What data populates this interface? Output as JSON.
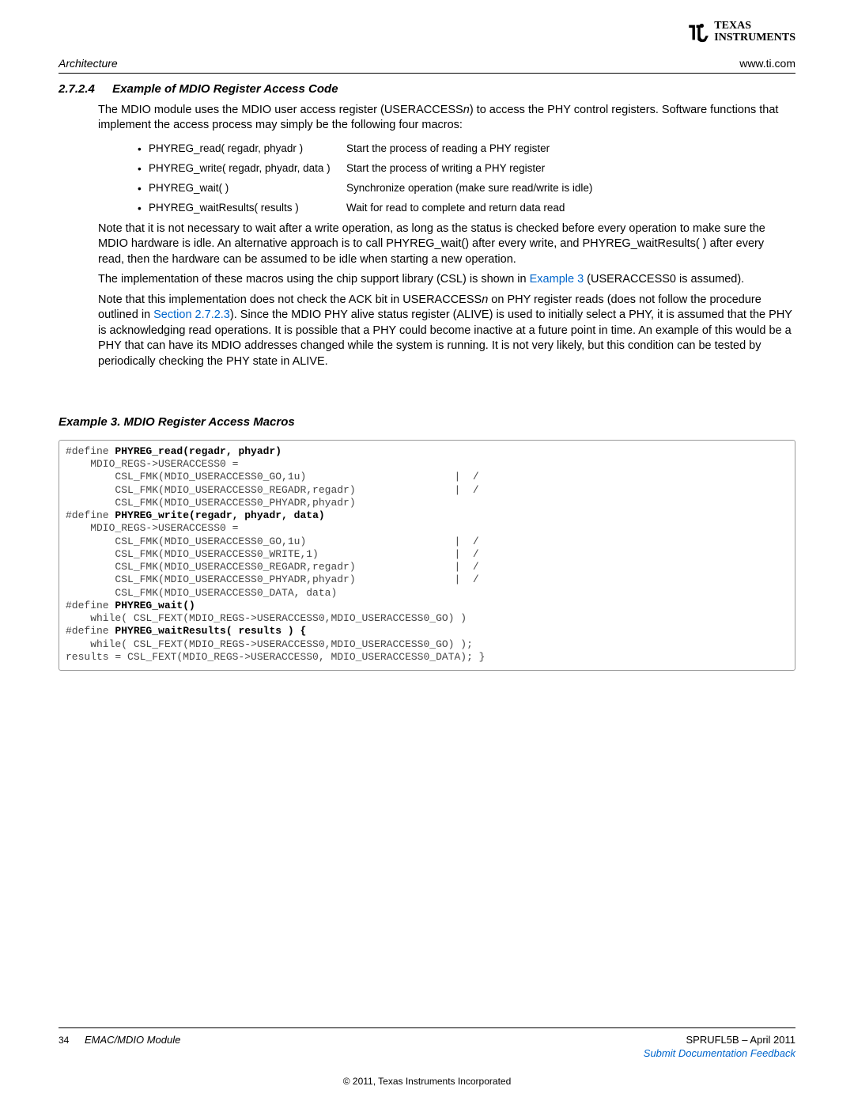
{
  "header": {
    "left": "Architecture",
    "right": "www.ti.com",
    "logo_top": "TEXAS",
    "logo_bottom": "INSTRUMENTS"
  },
  "section": {
    "number": "2.7.2.4",
    "title": "Example of MDIO Register Access Code"
  },
  "paragraphs": {
    "p1a": "The MDIO module uses the MDIO user access register (USERACCESS",
    "p1b": "n",
    "p1c": ") to access the PHY control registers. Software functions that implement the access process may simply be the following four macros:",
    "p2": "Note that it is not necessary to wait after a write operation, as long as the status is checked before every operation to make sure the MDIO hardware is idle. An alternative approach is to call PHYREG_wait() after every write, and PHYREG_waitResults( ) after every read, then the hardware can be assumed to be idle when starting a new operation.",
    "p3a": "The implementation of these macros using the chip support library (CSL) is shown in ",
    "p3_link": "Example 3",
    "p3b": " (USERACCESS0 is assumed).",
    "p4a": "Note that this implementation does not check the ACK bit in USERACCESS",
    "p4b": "n",
    "p4c": " on PHY register reads (does not follow the procedure outlined in ",
    "p4_link": "Section 2.7.2.3",
    "p4d": "). Since the MDIO PHY alive status register (ALIVE) is used to initially select a PHY, it is assumed that the PHY is acknowledging read operations. It is possible that a PHY could become inactive at a future point in time. An example of this would be a PHY that can have its MDIO addresses changed while the system is running. It is not very likely, but this condition can be tested by periodically checking the PHY state in ALIVE."
  },
  "macros": [
    {
      "name": "PHYREG_read( regadr, phyadr )",
      "desc": "Start the process of reading a PHY register"
    },
    {
      "name": "PHYREG_write( regadr, phyadr, data )",
      "desc": "Start the process of writing a PHY register"
    },
    {
      "name": "PHYREG_wait( )",
      "desc": "Synchronize operation (make sure read/write is idle)"
    },
    {
      "name": "PHYREG_waitResults( results )",
      "desc": "Wait for read to complete and return data read"
    }
  ],
  "example": {
    "title": "Example 3. MDIO Register Access Macros"
  },
  "code": {
    "l01a": "#define ",
    "l01b": "PHYREG_read(regadr, phyadr)",
    "l02": "    MDIO_REGS->USERACCESS0 =",
    "l03": "        CSL_FMK(MDIO_USERACCESS0_GO,1u)                        |  /",
    "l04": "        CSL_FMK(MDIO_USERACCESS0_REGADR,regadr)                |  /",
    "l05": "        CSL_FMK(MDIO_USERACCESS0_PHYADR,phyadr)",
    "l06a": "#define ",
    "l06b": "PHYREG_write(regadr, phyadr, data)",
    "l07": "    MDIO_REGS->USERACCESS0 =",
    "l08": "        CSL_FMK(MDIO_USERACCESS0_GO,1u)                        |  /",
    "l09": "        CSL_FMK(MDIO_USERACCESS0_WRITE,1)                      |  /",
    "l10": "        CSL_FMK(MDIO_USERACCESS0_REGADR,regadr)                |  /",
    "l11": "        CSL_FMK(MDIO_USERACCESS0_PHYADR,phyadr)                |  /",
    "l12": "        CSL_FMK(MDIO_USERACCESS0_DATA, data)",
    "l13a": "#define ",
    "l13b": "PHYREG_wait()",
    "l14": "    while( CSL_FEXT(MDIO_REGS->USERACCESS0,MDIO_USERACCESS0_GO) )",
    "l15a": "#define ",
    "l15b": "PHYREG_waitResults( results ) {",
    "l16": "    while( CSL_FEXT(MDIO_REGS->USERACCESS0,MDIO_USERACCESS0_GO) );",
    "l17": "results = CSL_FEXT(MDIO_REGS->USERACCESS0, MDIO_USERACCESS0_DATA); }"
  },
  "footer": {
    "page": "34",
    "module": "EMAC/MDIO Module",
    "docid": "SPRUFL5B – April 2011",
    "feedback": "Submit Documentation Feedback",
    "copyright": "© 2011, Texas Instruments Incorporated"
  }
}
